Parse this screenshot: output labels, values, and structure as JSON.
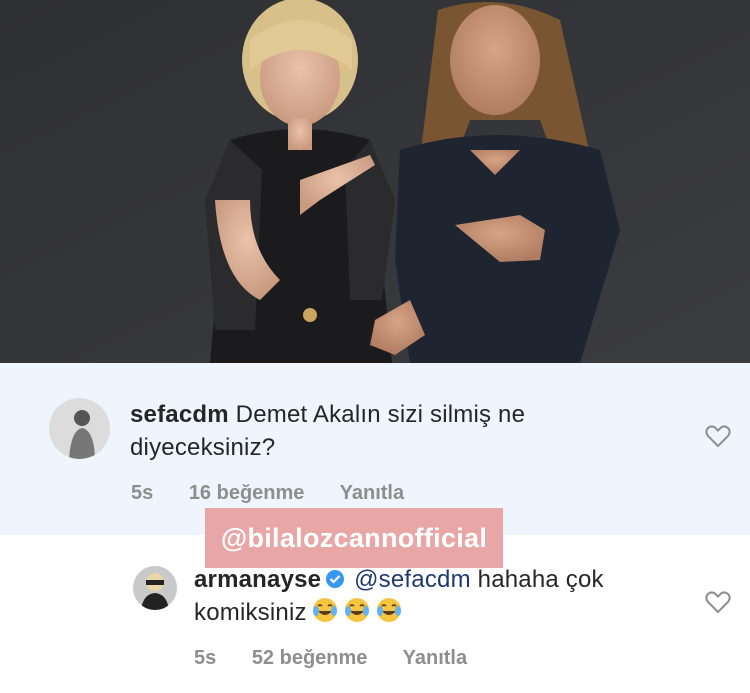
{
  "post_photo": {
    "alt": "photo"
  },
  "comments": [
    {
      "username": "sefacdm",
      "text": "Demet Akalın sizi silmiş ne diyeceksiniz?",
      "time": "5s",
      "likes": "16 beğenme",
      "reply": "Yanıtla"
    },
    {
      "username": "armanayse",
      "verified": true,
      "mention": "@sefacdm",
      "text": "hahaha çok komiksiniz",
      "emoji": "tears-of-joy-icon",
      "time": "5s",
      "likes": "52 beğenme",
      "reply": "Yanıtla"
    }
  ],
  "watermark": "@bilalozcannofficial",
  "colors": {
    "highlight_bg": "#eef5fc",
    "verified_blue": "#3897f0",
    "mention": "#1e3a6e",
    "meta_gray": "#8e8e8e",
    "watermark_bg": "#e8a6a6"
  }
}
